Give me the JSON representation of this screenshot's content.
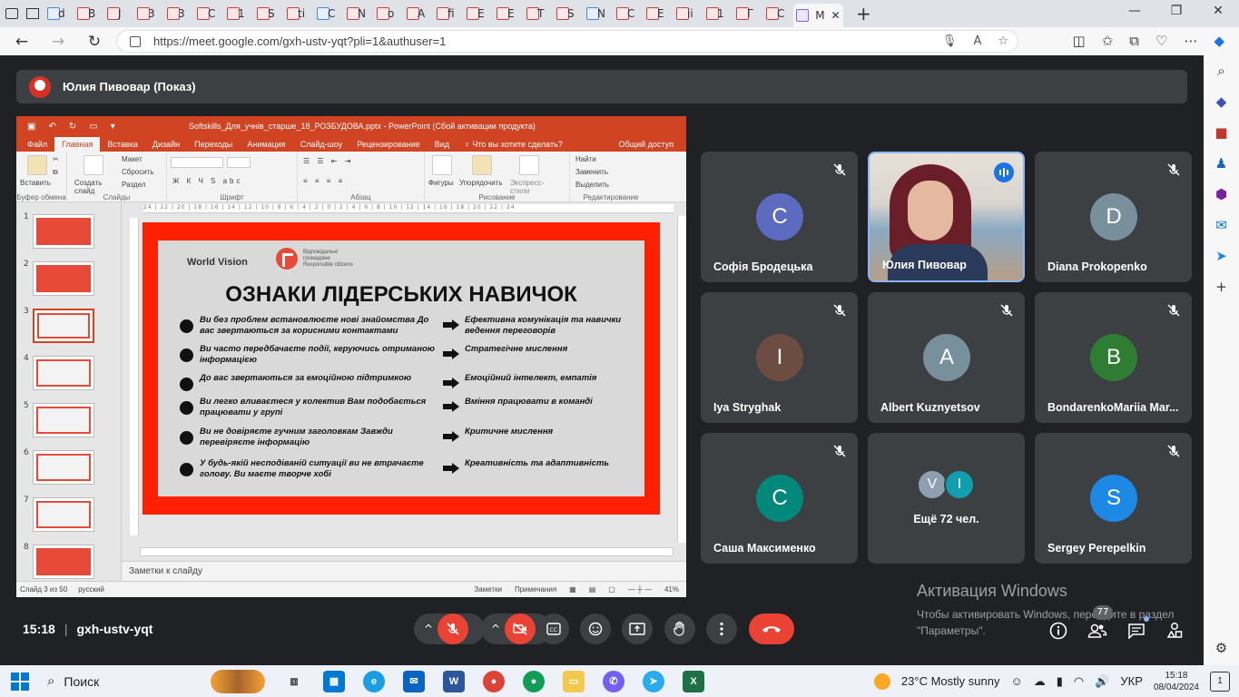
{
  "browser": {
    "active_tab_label": "M",
    "tab_texts": [
      "d",
      "B",
      "J",
      "3",
      "3",
      "C",
      "1",
      "S",
      "ti",
      "C",
      "N",
      "o",
      "A",
      "fi",
      "E",
      "E",
      "T",
      "S",
      "N",
      "C",
      "E",
      "ii",
      "1",
      "Γ",
      "C"
    ],
    "url": "https://meet.google.com/gxh-ustv-yqt?pli=1&authuser=1"
  },
  "meet": {
    "presenter_name": "Юлия Пивовар (Показ)",
    "meeting_time": "15:18",
    "meeting_code": "gxh-ustv-yqt",
    "participant_count": "77",
    "more_people": {
      "label": "Ещё 72 чел.",
      "avatars": [
        "V",
        "I"
      ],
      "colors": [
        "#8ea0b0",
        "#129eaf"
      ]
    },
    "participants": [
      {
        "name": "Софія Бродецька",
        "initial": "C",
        "color": "#5c6bc0",
        "muted": true
      },
      {
        "name": "Юлия Пивовар",
        "initial": "",
        "color": "",
        "muted": false,
        "video": true
      },
      {
        "name": "Diana Prokopenko",
        "initial": "D",
        "color": "#78909c",
        "muted": true
      },
      {
        "name": "Iya Stryghak",
        "initial": "I",
        "color": "#6d4c41",
        "muted": true
      },
      {
        "name": "Albert Kuznyetsov",
        "initial": "A",
        "color": "#78909c",
        "muted": true
      },
      {
        "name": "BondarenkoMariia Mar...",
        "initial": "B",
        "color": "#2e7d32",
        "muted": true
      },
      {
        "name": "Саша Максименко",
        "initial": "C",
        "color": "#00897b",
        "muted": true
      },
      {
        "name": "Sergey Perepelkin",
        "initial": "S",
        "color": "#1e88e5",
        "muted": true
      }
    ]
  },
  "activation": {
    "title": "Активация Windows",
    "line1": "Чтобы активировать Windows, перейдите в раздел",
    "line2": "\"Параметры\"."
  },
  "ppt": {
    "title": "Softskills_Для_учнів_старше_18_РОЗБУДОВА.pptx - PowerPoint (Сбой активации продукта)",
    "tabs": [
      "Файл",
      "Главная",
      "Вставка",
      "Дизайн",
      "Переходы",
      "Анимация",
      "Слайд-шоу",
      "Рецензирование",
      "Вид",
      "♀ Что вы хотите сделать?"
    ],
    "share": "Общий доступ",
    "ribbon": {
      "paste": "Вставить",
      "create_slide": "Создать слайд",
      "layout": "Макет",
      "reset": "Сбросить",
      "section": "Раздел",
      "shapes": "Фигуры",
      "arrange": "Упорядочить",
      "quick_styles": "Экспресс-стили",
      "find": "Найти",
      "replace": "Заменить",
      "select": "Выделить",
      "groups": [
        "Буфер обмена",
        "Слайды",
        "Шрифт",
        "Абзац",
        "Рисование",
        "Редактирование"
      ]
    },
    "thumb_numbers": [
      "1",
      "2",
      "3",
      "4",
      "5",
      "6",
      "7",
      "8"
    ],
    "ruler": "24 | 22 | 20 | 18 | 16 | 14 | 12 | 10 | 8 | 6 | 4 | 2 | 0 | 2 | 4 | 6 | 8 | 10 | 12 | 14 | 16 | 18 | 20 | 22 | 24",
    "notes_placeholder": "Заметки к слайду",
    "status": {
      "slide": "Слайд 3 из 50",
      "lang": "русский",
      "notes": "Заметки",
      "comments": "Примечания",
      "zoom": "41%"
    },
    "slide": {
      "brand": "World Vision",
      "partner_line1": "Відповідальні",
      "partner_line2": "громадяни",
      "partner_line3": "Responsible citizens",
      "title": "ОЗНАКИ ЛІДЕРСЬКИХ НАВИЧОК",
      "rows": [
        {
          "left": "Ви без проблем встановлюєте нові знайомства До вас звертаються за корисними контактами",
          "right": "Ефективна комунікація та навички ведення переговорів"
        },
        {
          "left": "Ви часто передбачаєте події, керуючись отриманою інформацією",
          "right": "Стратегічне мислення"
        },
        {
          "left": "До вас звертаються за емоційною підтримкою",
          "right": "Емоційний інтелект, емпатія"
        },
        {
          "left": "Ви легко вливаєтеся у колектив Вам подобається працювати у групі",
          "right": "Вміння працювати в команді"
        },
        {
          "left": "Ви не довіряєте гучним заголовкам Завжди перевіряєте інформацію",
          "right": "Критичне мислення"
        },
        {
          "left": "У будь-якій несподіваній ситуації ви не втрачаєте голову. Ви маєте творче хобі",
          "right": "Креативність та адаптивність"
        }
      ]
    }
  },
  "taskbar": {
    "search": "Поиск",
    "weather": "23°C  Mostly sunny",
    "lang": "УКР",
    "time": "15:18",
    "date": "08/04/2024",
    "notifications": "1"
  }
}
